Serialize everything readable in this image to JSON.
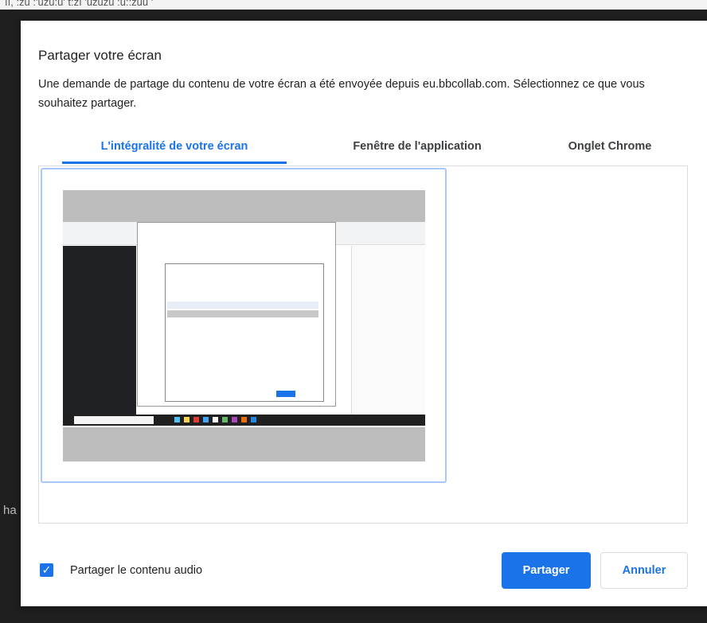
{
  "background": {
    "top_text": "ıı, :zu :'uzu:u' t:zı 'uzuzu :u::zuu '",
    "left_text": "ha"
  },
  "dialog": {
    "title": "Partager votre écran",
    "description": "Une demande de partage du contenu de votre écran a été envoyée depuis eu.bbcollab.com. Sélectionnez ce que vous souhaitez partager.",
    "tabs": [
      {
        "label": "L'intégralité de votre écran",
        "active": true
      },
      {
        "label": "Fenêtre de l'application",
        "active": false
      },
      {
        "label": "Onglet Chrome",
        "active": false
      }
    ],
    "audio": {
      "label": "Partager le contenu audio",
      "checked": true
    },
    "buttons": {
      "share": "Partager",
      "cancel": "Annuler"
    }
  },
  "colors": {
    "accent": "#1a73e8",
    "tile_border": "#a8c7fa"
  },
  "icons": {
    "check": "check-icon"
  }
}
